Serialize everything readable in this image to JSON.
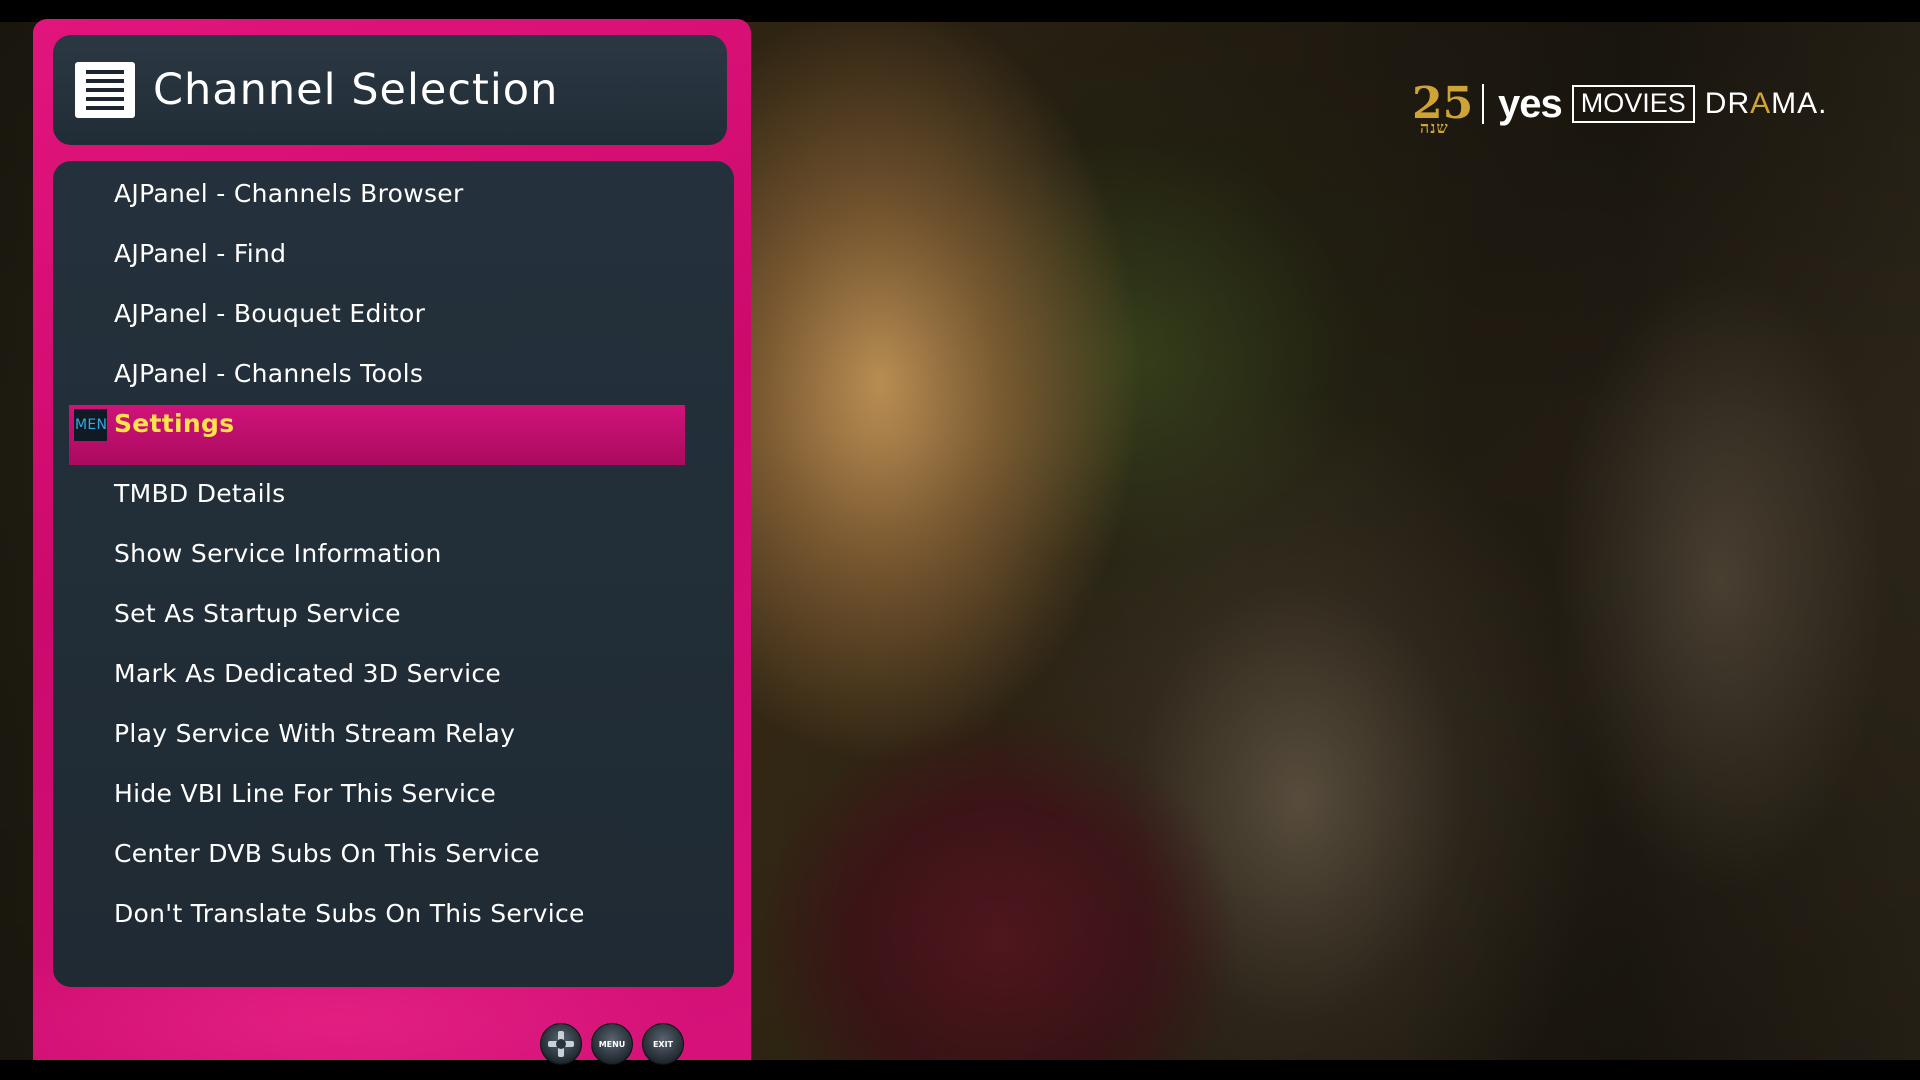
{
  "menu": {
    "title": "Channel Selection",
    "items": [
      {
        "label": "AJPanel - Channels Browser"
      },
      {
        "label": "AJPanel - Find"
      },
      {
        "label": "AJPanel - Bouquet Editor"
      },
      {
        "label": "AJPanel - Channels Tools"
      },
      {
        "label": "Settings",
        "selected": true,
        "key_badge": "MENU"
      },
      {
        "label": "TMBD Details"
      },
      {
        "label": "Show Service Information"
      },
      {
        "label": "Set As Startup Service"
      },
      {
        "label": "Mark As Dedicated 3D Service"
      },
      {
        "label": "Play Service With Stream Relay"
      },
      {
        "label": "Hide VBI Line For This Service"
      },
      {
        "label": "Center DVB Subs On This Service"
      },
      {
        "label": "Don't Translate Subs On This Service"
      }
    ],
    "selected_index": 4
  },
  "footer": {
    "buttons": [
      {
        "label": "",
        "icon": "dpad-icon"
      },
      {
        "label": "MENU"
      },
      {
        "label": "EXIT"
      }
    ]
  },
  "channel_logo": {
    "anniversary": "25",
    "anniversary_sub": "שנה",
    "brand": "yes",
    "boxed": "MOVIES",
    "genre_left": "DR",
    "genre_mid": "A",
    "genre_right": "MA."
  },
  "colors": {
    "panel_pink": "#d60f76",
    "list_bg": "#24313c",
    "selected_text": "#ffe34a",
    "key_badge_text": "#34a7e2",
    "logo_gold": "#cfa437"
  }
}
